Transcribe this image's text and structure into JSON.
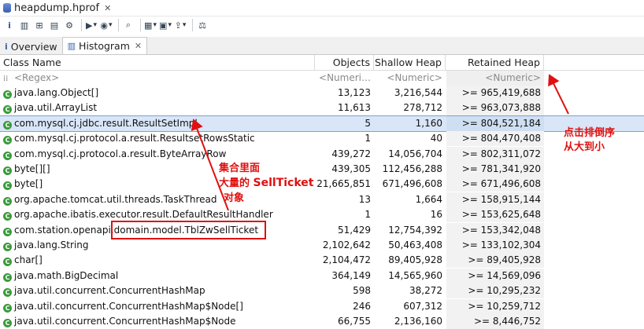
{
  "window": {
    "title": "heapdump.hprof",
    "close": "✕"
  },
  "tabs": [
    {
      "label": "Overview",
      "icon": "i"
    },
    {
      "label": "Histogram",
      "icon": "▥",
      "close": "✕"
    }
  ],
  "columns": {
    "class_name": "Class Name",
    "objects": "Objects",
    "shallow": "Shallow Heap",
    "retained": "Retained Heap"
  },
  "filter": {
    "class_name": "<Regex>",
    "objects": "<Numeri…",
    "shallow": "<Numeric>",
    "retained": "<Numeric>"
  },
  "rows": [
    {
      "name": "java.lang.Object[]",
      "objects": "13,123",
      "shallow": "3,216,544",
      "retained": ">= 965,419,688"
    },
    {
      "name": "java.util.ArrayList",
      "objects": "11,613",
      "shallow": "278,712",
      "retained": ">= 963,073,888"
    },
    {
      "name": "com.mysql.cj.jdbc.result.ResultSetImpl",
      "objects": "5",
      "shallow": "1,160",
      "retained": ">= 804,521,184"
    },
    {
      "name": "com.mysql.cj.protocol.a.result.ResultsetRowsStatic",
      "objects": "1",
      "shallow": "40",
      "retained": ">= 804,470,408"
    },
    {
      "name": "com.mysql.cj.protocol.a.result.ByteArrayRow",
      "objects": "439,272",
      "shallow": "14,056,704",
      "retained": ">= 802,311,072"
    },
    {
      "name": "byte[][]",
      "objects": "439,305",
      "shallow": "112,456,288",
      "retained": ">= 781,341,920"
    },
    {
      "name": "byte[]",
      "objects": "21,665,851",
      "shallow": "671,496,608",
      "retained": ">= 671,496,608"
    },
    {
      "name": "org.apache.tomcat.util.threads.TaskThread",
      "objects": "13",
      "shallow": "1,664",
      "retained": ">= 158,915,144"
    },
    {
      "name": "org.apache.ibatis.executor.result.DefaultResultHandler",
      "objects": "1",
      "shallow": "16",
      "retained": ">= 153,625,648"
    },
    {
      "name": "com.station.openapi.domain.model.TblZwSellTicket",
      "objects": "51,429",
      "shallow": "12,754,392",
      "retained": ">= 153,342,048"
    },
    {
      "name": "java.lang.String",
      "objects": "2,102,642",
      "shallow": "50,463,408",
      "retained": ">= 133,102,304"
    },
    {
      "name": "char[]",
      "objects": "2,104,472",
      "shallow": "89,405,928",
      "retained": ">= 89,405,928"
    },
    {
      "name": "java.math.BigDecimal",
      "objects": "364,149",
      "shallow": "14,565,960",
      "retained": ">= 14,569,096"
    },
    {
      "name": "java.util.concurrent.ConcurrentHashMap",
      "objects": "598",
      "shallow": "38,272",
      "retained": ">= 10,295,232"
    },
    {
      "name": "java.util.concurrent.ConcurrentHashMap$Node[]",
      "objects": "246",
      "shallow": "607,312",
      "retained": ">= 10,259,712"
    },
    {
      "name": "java.util.concurrent.ConcurrentHashMap$Node",
      "objects": "66,755",
      "shallow": "2,136,160",
      "retained": ">= 8,446,752"
    }
  ],
  "annotations": {
    "sort_note_1": "点击排倒序",
    "sort_note_2": "从大到小",
    "set_note_1": "集合里面",
    "set_note_2a": "大量的 ",
    "set_note_2b": "SellTicket",
    "set_note_3": "对象"
  },
  "colors": {
    "annotation": "#e01010",
    "selection": "#d8e6f7",
    "class_icon": "#3b9a3b"
  }
}
